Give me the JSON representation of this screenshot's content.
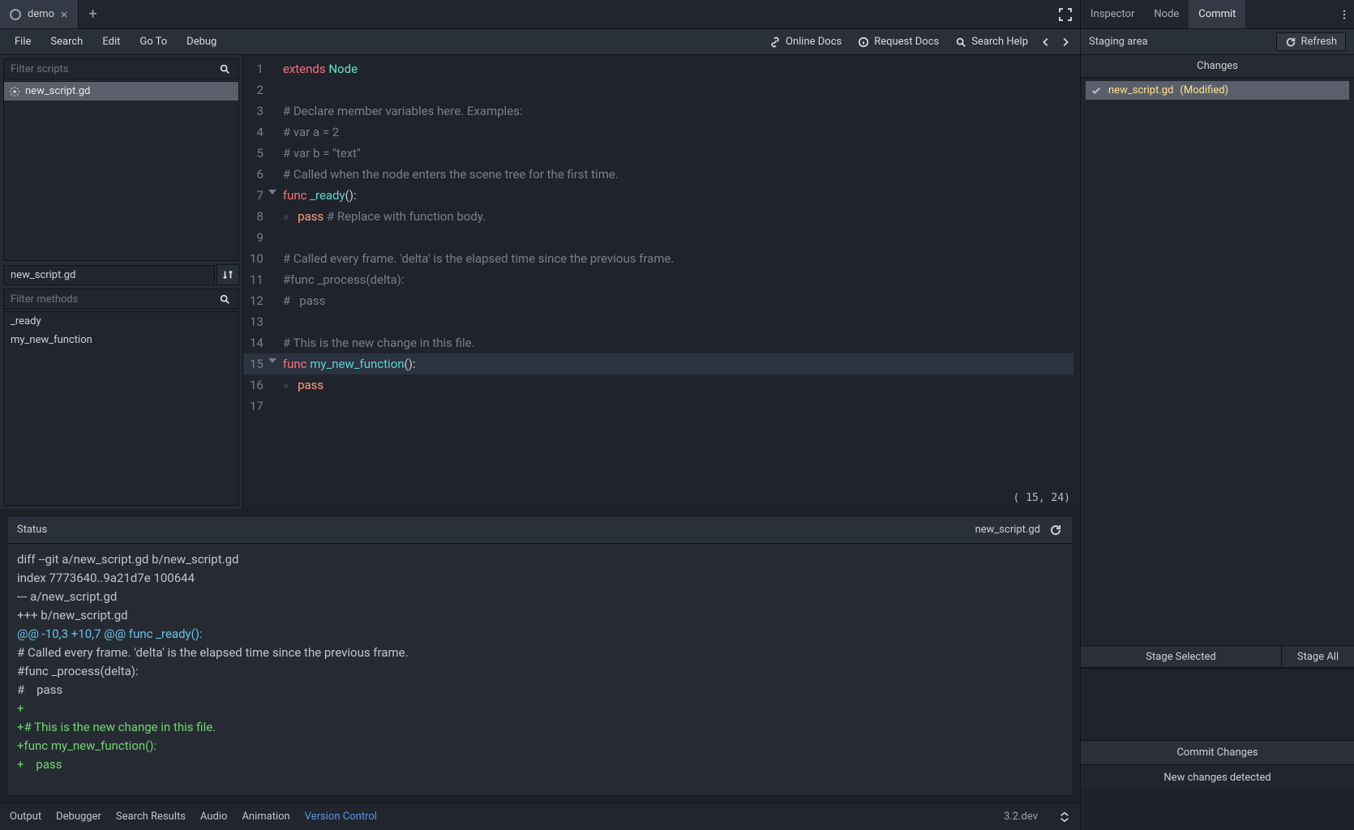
{
  "scene_tab": {
    "name": "demo"
  },
  "menu": {
    "file": "File",
    "search": "Search",
    "edit": "Edit",
    "goto": "Go To",
    "debug": "Debug"
  },
  "help_links": {
    "online_docs": "Online Docs",
    "request_docs": "Request Docs",
    "search_help": "Search Help"
  },
  "script_filter_placeholder": "Filter scripts",
  "script_list": [
    {
      "name": "new_script.gd"
    }
  ],
  "path_label": "new_script.gd",
  "method_filter_placeholder": "Filter methods",
  "methods": [
    "_ready",
    "my_new_function"
  ],
  "cursor_label": "( 15, 24)",
  "code_lines": [
    {
      "n": 1,
      "tokens": [
        [
          "kw",
          "extends"
        ],
        [
          "plain",
          " "
        ],
        [
          "type",
          "Node"
        ]
      ]
    },
    {
      "n": 2,
      "tokens": []
    },
    {
      "n": 3,
      "tokens": [
        [
          "comment",
          "# Declare member variables here. Examples:"
        ]
      ]
    },
    {
      "n": 4,
      "tokens": [
        [
          "comment",
          "# var a = 2"
        ]
      ]
    },
    {
      "n": 5,
      "tokens": [
        [
          "comment",
          "# var b = \"text\""
        ]
      ]
    },
    {
      "n": 6,
      "tokens": [
        [
          "comment",
          "# Called when the node enters the scene tree for the first time."
        ]
      ]
    },
    {
      "n": 7,
      "fold": true,
      "tokens": [
        [
          "kw",
          "func"
        ],
        [
          "plain",
          " "
        ],
        [
          "fn",
          "_ready"
        ],
        [
          "brace",
          "():"
        ]
      ]
    },
    {
      "n": 8,
      "tokens": [
        [
          "tab",
          "»   "
        ],
        [
          "pass",
          "pass"
        ],
        [
          "plain",
          " "
        ],
        [
          "comment",
          "# Replace with function body."
        ]
      ]
    },
    {
      "n": 9,
      "tokens": []
    },
    {
      "n": 10,
      "tokens": [
        [
          "comment",
          "# Called every frame. 'delta' is the elapsed time since the previous frame."
        ]
      ]
    },
    {
      "n": 11,
      "tokens": [
        [
          "comment",
          "#func _process(delta):"
        ]
      ]
    },
    {
      "n": 12,
      "tokens": [
        [
          "comment",
          "#   pass"
        ]
      ]
    },
    {
      "n": 13,
      "tokens": []
    },
    {
      "n": 14,
      "tokens": [
        [
          "comment",
          "# This is the new change in this file."
        ]
      ]
    },
    {
      "n": 15,
      "hl": true,
      "fold": true,
      "tokens": [
        [
          "kw",
          "func"
        ],
        [
          "plain",
          " "
        ],
        [
          "fn",
          "my_new_function"
        ],
        [
          "brace",
          "():"
        ]
      ]
    },
    {
      "n": 16,
      "tokens": [
        [
          "tab",
          "»   "
        ],
        [
          "pass",
          "pass"
        ]
      ]
    },
    {
      "n": 17,
      "tokens": []
    }
  ],
  "diff": {
    "status_label": "Status",
    "file_label": "new_script.gd",
    "lines": [
      {
        "cls": "plain",
        "text": "diff --git a/new_script.gd b/new_script.gd"
      },
      {
        "cls": "plain",
        "text": "index 7773640..9a21d7e 100644"
      },
      {
        "cls": "plain",
        "text": "--- a/new_script.gd"
      },
      {
        "cls": "plain",
        "text": "+++ b/new_script.gd"
      },
      {
        "cls": "at",
        "text": "@@ -10,3 +10,7 @@ func _ready():"
      },
      {
        "cls": "plain",
        "text": "# Called every frame. 'delta' is the elapsed time since the previous frame."
      },
      {
        "cls": "plain",
        "text": "#func _process(delta):"
      },
      {
        "cls": "plain",
        "text": "#    pass"
      },
      {
        "cls": "add",
        "text": "+"
      },
      {
        "cls": "add",
        "text": "+# This is the new change in this file."
      },
      {
        "cls": "add",
        "text": "+func my_new_function():"
      },
      {
        "cls": "add",
        "text": "+    pass"
      }
    ]
  },
  "bottom_tabs": {
    "output": "Output",
    "debugger": "Debugger",
    "search_results": "Search Results",
    "audio": "Audio",
    "animation": "Animation",
    "vcs": "Version Control"
  },
  "version_label": "3.2.dev",
  "dock_tabs": {
    "inspector": "Inspector",
    "node": "Node",
    "commit": "Commit"
  },
  "staging_label": "Staging area",
  "refresh_label": "Refresh",
  "changes_header": "Changes",
  "changes": [
    {
      "name": "new_script.gd",
      "status": "(Modified)"
    }
  ],
  "stage_selected": "Stage Selected",
  "stage_all": "Stage All",
  "commit_changes": "Commit Changes",
  "vcs_status": "New changes detected"
}
